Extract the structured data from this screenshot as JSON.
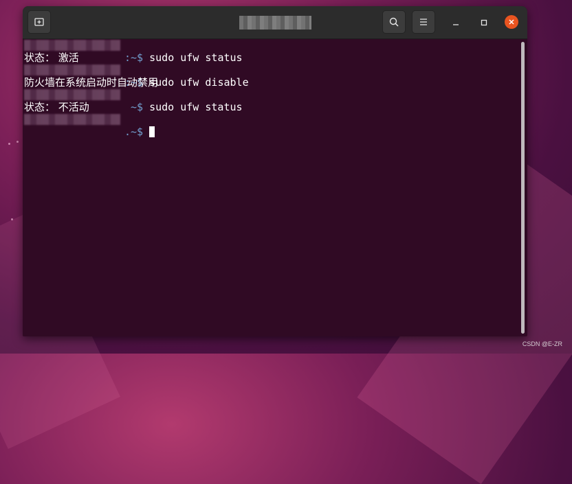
{
  "window": {
    "icons": {
      "new_tab": "new-tab-icon",
      "search": "search-icon",
      "menu": "hamburger-menu-icon",
      "minimize": "minimize-icon",
      "maximize": "maximize-icon",
      "close": "close-icon"
    },
    "colors": {
      "terminal_bg": "#300a24",
      "titlebar_bg": "#2c2c2c",
      "path_color": "#729fcf",
      "close_accent": "#e95420"
    }
  },
  "terminal": {
    "lines": [
      {
        "type": "prompt",
        "prompt": ":~$ ",
        "command": "sudo ufw status"
      },
      {
        "type": "output",
        "text": "状态： 激活"
      },
      {
        "type": "prompt",
        "prompt": ":~$ ",
        "command": "sudo ufw disable"
      },
      {
        "type": "output",
        "text": "防火墙在系统启动时自动禁用"
      },
      {
        "type": "prompt",
        "prompt": "~$ ",
        "command": "sudo ufw status"
      },
      {
        "type": "output",
        "text": "状态： 不活动"
      },
      {
        "type": "prompt",
        "prompt": ".~$ ",
        "command": ""
      }
    ]
  },
  "watermark": "CSDN @E-ZR"
}
